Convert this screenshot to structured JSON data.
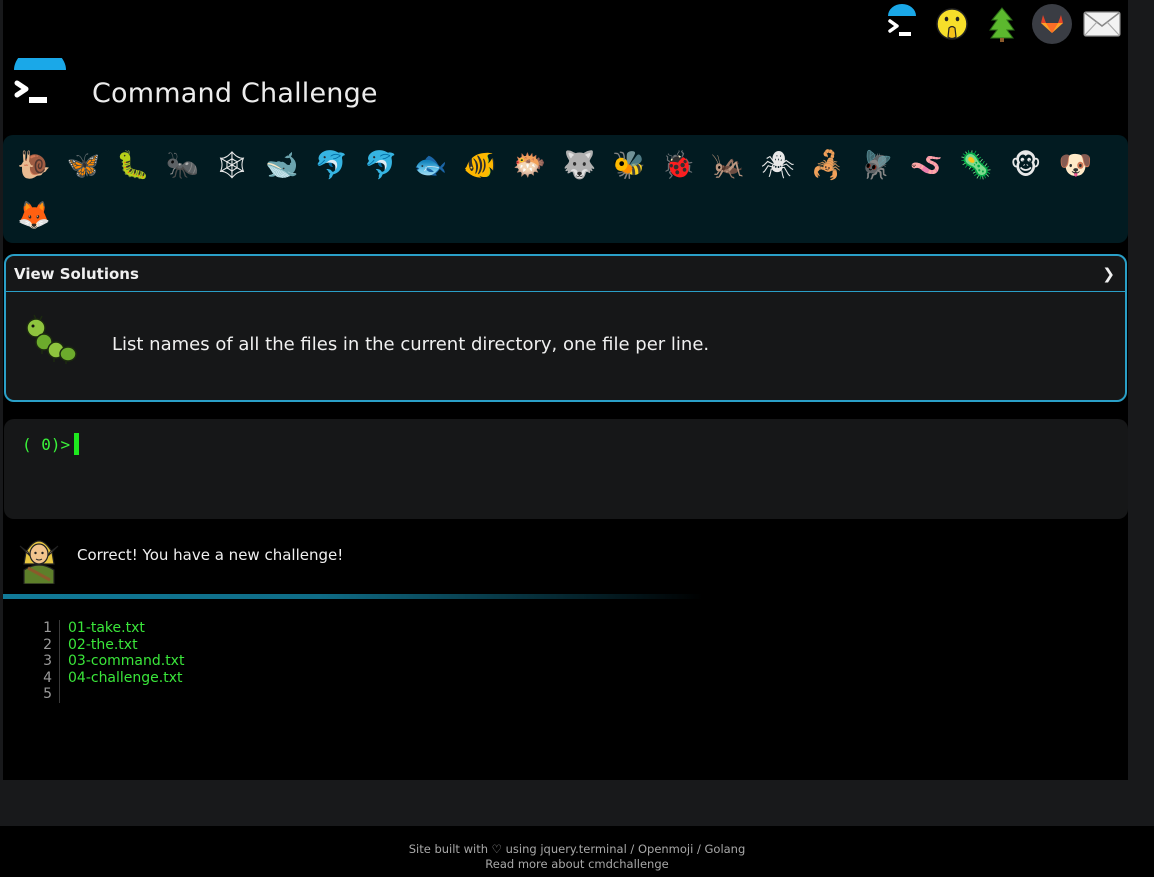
{
  "app": {
    "title": "Command Challenge"
  },
  "topbar": {
    "icons": [
      "terminal-logo-icon",
      "shushing-face-icon",
      "evergreen-tree-icon",
      "gitlab-icon",
      "envelope-icon"
    ]
  },
  "creatures": [
    {
      "name": "snail",
      "glyph": "🐌"
    },
    {
      "name": "butterfly",
      "glyph": "🦋"
    },
    {
      "name": "caterpillar",
      "glyph": "🐛"
    },
    {
      "name": "ant",
      "glyph": "🐜"
    },
    {
      "name": "spider-web",
      "glyph": "🕸"
    },
    {
      "name": "whale",
      "glyph": "🐋"
    },
    {
      "name": "dolphin",
      "glyph": "🐬"
    },
    {
      "name": "dolphin-gray",
      "glyph": "🐬"
    },
    {
      "name": "fish",
      "glyph": "🐟"
    },
    {
      "name": "tropical-fish",
      "glyph": "🐠"
    },
    {
      "name": "blowfish",
      "glyph": "🐡"
    },
    {
      "name": "wolf",
      "glyph": "🐺"
    },
    {
      "name": "bee",
      "glyph": "🐝"
    },
    {
      "name": "lady-beetle",
      "glyph": "🐞"
    },
    {
      "name": "cricket",
      "glyph": "🦗"
    },
    {
      "name": "spider",
      "glyph": "🕷"
    },
    {
      "name": "scorpion",
      "glyph": "🦂"
    },
    {
      "name": "fly",
      "glyph": "🪰"
    },
    {
      "name": "worm",
      "glyph": "🪱"
    },
    {
      "name": "microbe",
      "glyph": "🦠"
    },
    {
      "name": "monkey-face",
      "glyph": "🐵"
    },
    {
      "name": "dog-face",
      "glyph": "🐶"
    },
    {
      "name": "fox",
      "glyph": "🦊"
    }
  ],
  "solutions_panel": {
    "label": "View Solutions",
    "chevron": "❯",
    "task": "List names of all the files in the current directory, one file per line."
  },
  "terminal": {
    "prompt": "( 0)>"
  },
  "message": {
    "text": "Correct! You have a new challenge!"
  },
  "output": {
    "line_numbers": [
      "1",
      "2",
      "3",
      "4",
      "5"
    ],
    "lines": [
      "01-take.txt",
      "02-the.txt",
      "03-command.txt",
      "04-challenge.txt",
      ""
    ]
  },
  "footer": {
    "line1": "Site built with ♡ using jquery.terminal / Openmoji / Golang",
    "line2": "Read more about cmdchallenge"
  },
  "colors": {
    "accent": "#2a9fc7",
    "terminal_green": "#3af23a",
    "panel_bg": "#161718",
    "creature_strip_bg": "#021b21"
  }
}
